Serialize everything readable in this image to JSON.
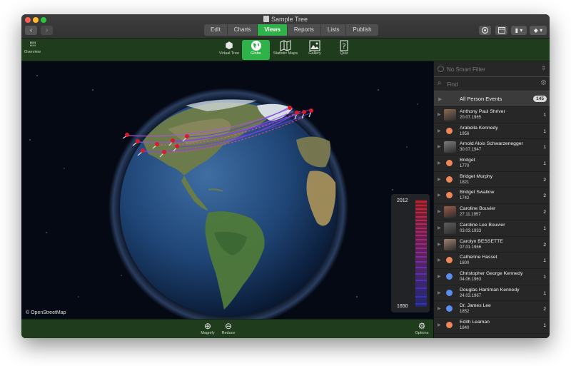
{
  "window": {
    "title": "Sample Tree"
  },
  "nav": {
    "back": "‹",
    "forward": "›"
  },
  "segments": [
    "Edit",
    "Charts",
    "Views",
    "Reports",
    "Lists",
    "Publish"
  ],
  "active_segment": "Views",
  "toolbar": {
    "overview": "Overview",
    "tools": [
      {
        "label": "Virtual Tree",
        "icon": "cube-icon"
      },
      {
        "label": "Globe",
        "icon": "globe-icon"
      },
      {
        "label": "Statistic Maps",
        "icon": "map-icon"
      },
      {
        "label": "Gallery",
        "icon": "gallery-icon"
      },
      {
        "label": "Quiz",
        "icon": "quiz-icon"
      }
    ],
    "active_tool": "Globe"
  },
  "map": {
    "attribution": "© OpenStreetMap",
    "legend": {
      "top": "2012",
      "bottom": "1650"
    }
  },
  "bottom": {
    "magnify": "Magnify",
    "reduce": "Reduce",
    "options": "Options"
  },
  "sidebar": {
    "filter_placeholder": "No Smart Filter",
    "find_placeholder": "Find",
    "all_label": "All Person Events",
    "all_count": "145",
    "rows": [
      {
        "name": "Anthony Paul Shriver",
        "date": "20.07.1965",
        "count": "1",
        "avatar": "photo",
        "color": "#8a6a55"
      },
      {
        "name": "Arabella Kennedy",
        "date": "1956",
        "count": "1",
        "avatar": "dot",
        "color": "#f0875a"
      },
      {
        "name": "Arnold Alois Schwarzenegger",
        "date": "30.07.1947",
        "count": "1",
        "avatar": "photo",
        "color": "#7d7d7d"
      },
      {
        "name": "Bridget",
        "date": "1770",
        "count": "1",
        "avatar": "dot",
        "color": "#f0875a"
      },
      {
        "name": "Bridget Murphy",
        "date": "1821",
        "count": "2",
        "avatar": "dot",
        "color": "#f0875a"
      },
      {
        "name": "Bridget Swallow",
        "date": "1742",
        "count": "2",
        "avatar": "dot",
        "color": "#f0875a"
      },
      {
        "name": "Caroline Bouvier",
        "date": "27.11.1957",
        "count": "2",
        "avatar": "photo",
        "color": "#9a5a48"
      },
      {
        "name": "Caroline Lee Bouvier",
        "date": "03.03.1933",
        "count": "1",
        "avatar": "photo",
        "color": "#5e5e5e"
      },
      {
        "name": "Carolyn BESSETTE",
        "date": "07.01.1966",
        "count": "2",
        "avatar": "photo",
        "color": "#a08070"
      },
      {
        "name": "Catherine Hasset",
        "date": "1800",
        "count": "1",
        "avatar": "dot",
        "color": "#f0875a"
      },
      {
        "name": "Christopher George Kennedy",
        "date": "04.06.1963",
        "count": "1",
        "avatar": "dot",
        "color": "#5b8def"
      },
      {
        "name": "Douglas Harriman Kennedy",
        "date": "24.03.1967",
        "count": "1",
        "avatar": "dot",
        "color": "#5b8def"
      },
      {
        "name": "Dr. James Lee",
        "date": "1852",
        "count": "2",
        "avatar": "dot",
        "color": "#5b8def"
      },
      {
        "name": "Edith Leaman",
        "date": "1840",
        "count": "1",
        "avatar": "dot",
        "color": "#f0875a"
      }
    ]
  }
}
